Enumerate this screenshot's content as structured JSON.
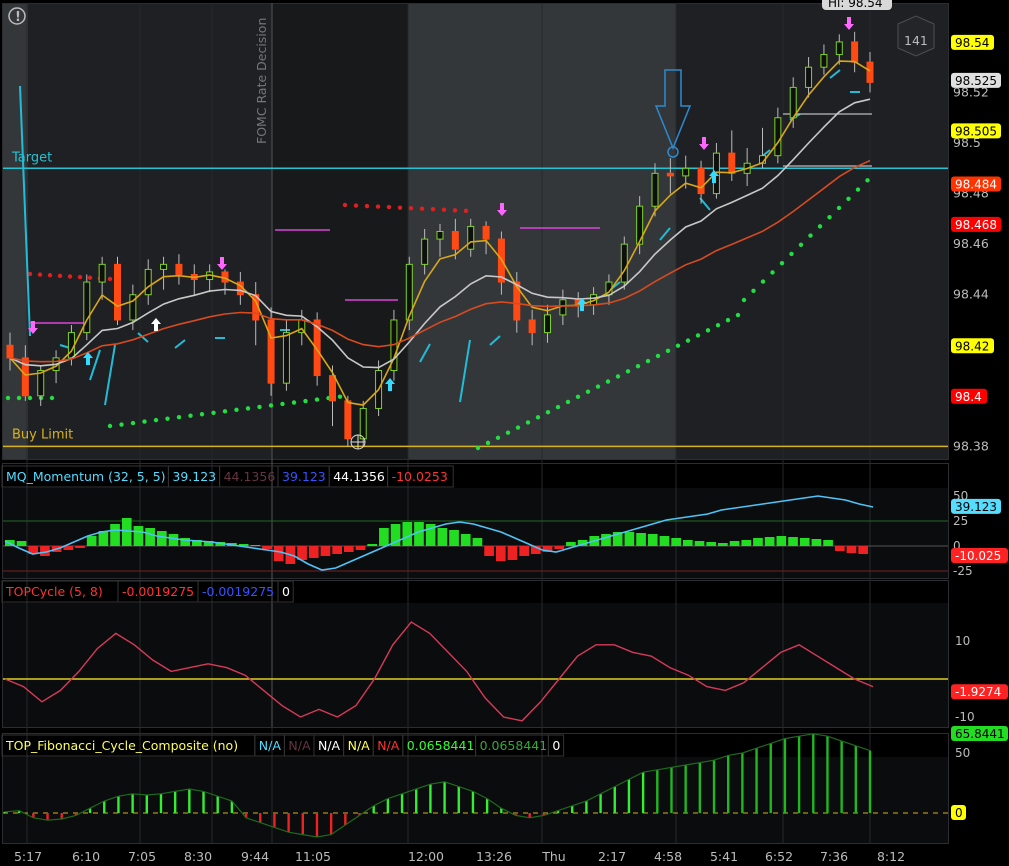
{
  "alert_icon": "exclamation-circle-icon",
  "price_panel": {
    "event_label": "FOMC Rate Decision",
    "target_label": "Target",
    "buy_limit_label": "Buy Limit",
    "counter_badge": "141",
    "high_label": "Hi: 98.54",
    "price_ticks": [
      "98.52",
      "98.5",
      "98.48",
      "98.46",
      "98.44",
      "98.42",
      "98.4",
      "98.38"
    ],
    "price_badges": [
      {
        "text": "98.54",
        "bg": "#ffff00",
        "fg": "#000000",
        "value": 98.54
      },
      {
        "text": "98.525",
        "bg": "#e0e0e0",
        "fg": "#000000",
        "value": 98.525
      },
      {
        "text": "98.505",
        "bg": "#ffff00",
        "fg": "#000000",
        "value": 98.505
      },
      {
        "text": "98.484",
        "bg": "#ff3300",
        "fg": "#ffffff",
        "value": 98.484
      },
      {
        "text": "98.468",
        "bg": "#ff0000",
        "fg": "#ffffff",
        "value": 98.468
      },
      {
        "text": "98.42",
        "bg": "#ffff00",
        "fg": "#000000",
        "value": 98.42
      },
      {
        "text": "98.4",
        "bg": "#ff0000",
        "fg": "#ffffff",
        "value": 98.4
      }
    ]
  },
  "momentum_panel": {
    "title": "MQ_Momentum (32, 5, 5)",
    "values": [
      "39.123",
      "44.1356",
      "39.123",
      "44.1356",
      "-10.0253"
    ],
    "value_colors": [
      "#55ddff",
      "#663344",
      "#3355ff",
      "#ffffff",
      "#ff3333"
    ],
    "ticks": [
      "50",
      "25",
      "0",
      "-25"
    ],
    "badges": [
      {
        "text": "39.123",
        "bg": "#55ddff",
        "fg": "#000000"
      },
      {
        "text": "-10.025",
        "bg": "#ff2222",
        "fg": "#ffffff"
      }
    ]
  },
  "cycle_panel": {
    "title": "TOPCycle (5, 8)",
    "values": [
      "-0.0019275",
      "-0.0019275",
      "0"
    ],
    "value_colors": [
      "#ff3333",
      "#3355ff",
      "#ffffff"
    ],
    "ticks": [
      "10",
      "-10"
    ],
    "badge": {
      "text": "-1.9274",
      "bg": "#ff2222",
      "fg": "#ffffff"
    }
  },
  "fib_panel": {
    "title": "TOP_Fibonacci_Cycle_Composite (no)",
    "values": [
      "N/A",
      "N/A",
      "N/A",
      "N/A",
      "N/A",
      "0.0658441",
      "0.0658441",
      "0"
    ],
    "value_colors": [
      "#55ddff",
      "#663344",
      "#ffffff",
      "#ffff55",
      "#ff3333",
      "#33ff33",
      "#33aa33",
      "#ffffff"
    ],
    "ticks": [
      "50"
    ],
    "badges": [
      {
        "text": "65.8441",
        "bg": "#22dd22",
        "fg": "#000000"
      },
      {
        "text": "0",
        "bg": "#ffff00",
        "fg": "#000000"
      }
    ]
  },
  "time_axis": [
    "5:17",
    "6:10",
    "7:05",
    "8:30",
    "9:44",
    "11:05",
    "12:00",
    "13:26",
    "Thu",
    "2:17",
    "4:58",
    "5:41",
    "6:52",
    "7:36",
    "8:12"
  ],
  "chart_data": {
    "type": "candlestick",
    "y_range": [
      98.375,
      98.555
    ],
    "target": 98.49,
    "buy_limit": 98.38,
    "candles": [
      [
        98.42,
        98.415,
        98.425,
        98.41
      ],
      [
        98.415,
        98.4,
        98.42,
        98.398
      ],
      [
        98.4,
        98.41,
        98.412,
        98.396
      ],
      [
        98.41,
        98.415,
        98.418,
        98.405
      ],
      [
        98.415,
        98.425,
        98.428,
        98.412
      ],
      [
        98.425,
        98.445,
        98.448,
        98.422
      ],
      [
        98.445,
        98.452,
        98.455,
        98.438
      ],
      [
        98.452,
        98.43,
        98.455,
        98.428
      ],
      [
        98.43,
        98.44,
        98.444,
        98.426
      ],
      [
        98.44,
        98.45,
        98.454,
        98.436
      ],
      [
        98.45,
        98.452,
        98.455,
        98.442
      ],
      [
        98.452,
        98.448,
        98.456,
        98.444
      ],
      [
        98.448,
        98.446,
        98.452,
        98.44
      ],
      [
        98.446,
        98.449,
        98.452,
        98.441
      ],
      [
        98.449,
        98.445,
        98.45,
        98.44
      ],
      [
        98.445,
        98.44,
        98.449,
        98.436
      ],
      [
        98.44,
        98.43,
        98.445,
        98.42
      ],
      [
        98.43,
        98.405,
        98.435,
        98.4
      ],
      [
        98.405,
        98.425,
        98.43,
        98.402
      ],
      [
        98.425,
        98.43,
        98.434,
        98.42
      ],
      [
        98.43,
        98.408,
        98.433,
        98.404
      ],
      [
        98.408,
        98.398,
        98.412,
        98.388
      ],
      [
        98.398,
        98.383,
        98.4,
        98.38
      ],
      [
        98.383,
        98.395,
        98.398,
        98.38
      ],
      [
        98.395,
        98.41,
        98.414,
        98.392
      ],
      [
        98.41,
        98.43,
        98.434,
        98.406
      ],
      [
        98.43,
        98.452,
        98.455,
        98.426
      ],
      [
        98.452,
        98.462,
        98.466,
        98.448
      ],
      [
        98.462,
        98.465,
        98.468,
        98.455
      ],
      [
        98.465,
        98.458,
        98.47,
        98.454
      ],
      [
        98.458,
        98.467,
        98.47,
        98.455
      ],
      [
        98.467,
        98.462,
        98.469,
        98.456
      ],
      [
        98.462,
        98.445,
        98.465,
        98.44
      ],
      [
        98.445,
        98.43,
        98.449,
        98.425
      ],
      [
        98.43,
        98.425,
        98.434,
        98.42
      ],
      [
        98.425,
        98.432,
        98.436,
        98.421
      ],
      [
        98.432,
        98.438,
        98.442,
        98.428
      ],
      [
        98.438,
        98.436,
        98.441,
        98.431
      ],
      [
        98.436,
        98.44,
        98.443,
        98.432
      ],
      [
        98.44,
        98.445,
        98.448,
        98.436
      ],
      [
        98.445,
        98.46,
        98.463,
        98.442
      ],
      [
        98.46,
        98.475,
        98.479,
        98.456
      ],
      [
        98.475,
        98.488,
        98.492,
        98.471
      ],
      [
        98.488,
        98.487,
        98.494,
        98.48
      ],
      [
        98.487,
        98.49,
        98.495,
        98.482
      ],
      [
        98.49,
        98.48,
        98.493,
        98.476
      ],
      [
        98.48,
        98.496,
        98.5,
        98.478
      ],
      [
        98.496,
        98.488,
        98.505,
        98.485
      ],
      [
        98.488,
        98.492,
        98.498,
        98.483
      ],
      [
        98.492,
        98.495,
        98.506,
        98.49
      ],
      [
        98.495,
        98.51,
        98.514,
        98.492
      ],
      [
        98.51,
        98.522,
        98.526,
        98.506
      ],
      [
        98.522,
        98.53,
        98.534,
        98.518
      ],
      [
        98.53,
        98.535,
        98.539,
        98.527
      ],
      [
        98.535,
        98.54,
        98.543,
        98.531
      ],
      [
        98.54,
        98.532,
        98.544,
        98.528
      ],
      [
        98.532,
        98.524,
        98.536,
        98.52
      ]
    ]
  }
}
